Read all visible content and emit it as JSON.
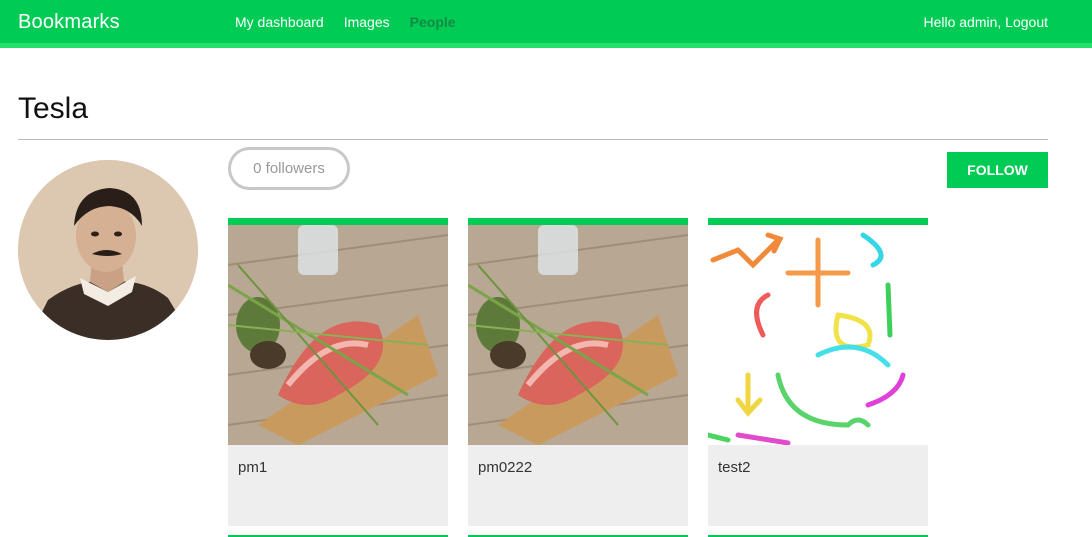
{
  "header": {
    "logo": "Bookmarks",
    "nav": [
      {
        "label": "My dashboard",
        "active": false
      },
      {
        "label": "Images",
        "active": false
      },
      {
        "label": "People",
        "active": true
      }
    ],
    "greeting": "Hello admin,",
    "logout": "Logout"
  },
  "profile": {
    "name": "Tesla",
    "followers": "0 followers",
    "follow_button": "FOLLOW"
  },
  "images": [
    {
      "title": "pm1",
      "thumb": "food-plate"
    },
    {
      "title": "pm0222",
      "thumb": "food-plate"
    },
    {
      "title": "test2",
      "thumb": "colored-arrows"
    }
  ],
  "colors": {
    "brand": "#00cc55",
    "active_nav": "#128a44",
    "caption_bg": "#eeeeee"
  }
}
